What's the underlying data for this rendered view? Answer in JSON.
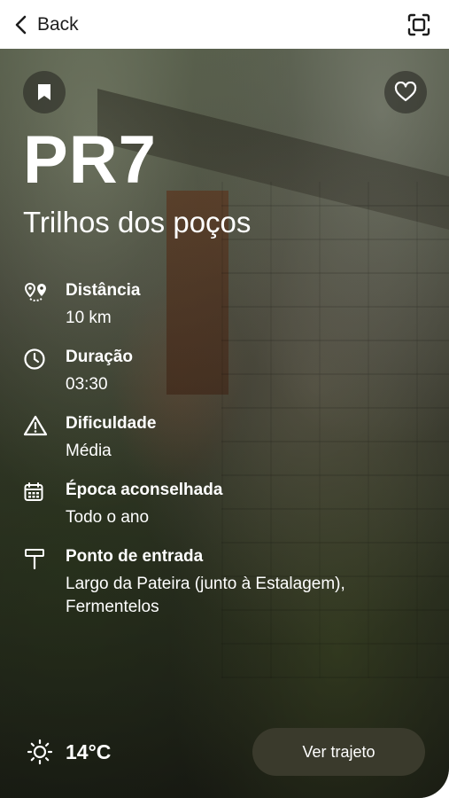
{
  "nav": {
    "back_label": "Back",
    "back_icon": "chevron-left-icon",
    "scan_icon": "scan-frame-icon"
  },
  "hero": {
    "bookmark_icon": "bookmark-icon",
    "favorite_icon": "heart-icon",
    "route_code": "PR7",
    "route_name": "Trilhos dos poços"
  },
  "details": [
    {
      "icon": "map-pins-icon",
      "label": "Distância",
      "value": "10 km"
    },
    {
      "icon": "clock-icon",
      "label": "Duração",
      "value": "03:30"
    },
    {
      "icon": "warning-icon",
      "label": "Dificuldade",
      "value": "Média"
    },
    {
      "icon": "calendar-icon",
      "label": "Época aconselhada",
      "value": "Todo o ano"
    },
    {
      "icon": "signpost-icon",
      "label": "Ponto de entrada",
      "value": "Largo da Pateira (junto à Estalagem), Fermentelos"
    }
  ],
  "weather": {
    "icon": "sun-icon",
    "temperature": "14°C"
  },
  "actions": {
    "route_button_label": "Ver trajeto"
  },
  "colors": {
    "text_light": "#ffffff",
    "button_bg": "#3a3a2c",
    "nav_text": "#1d1d1d"
  }
}
